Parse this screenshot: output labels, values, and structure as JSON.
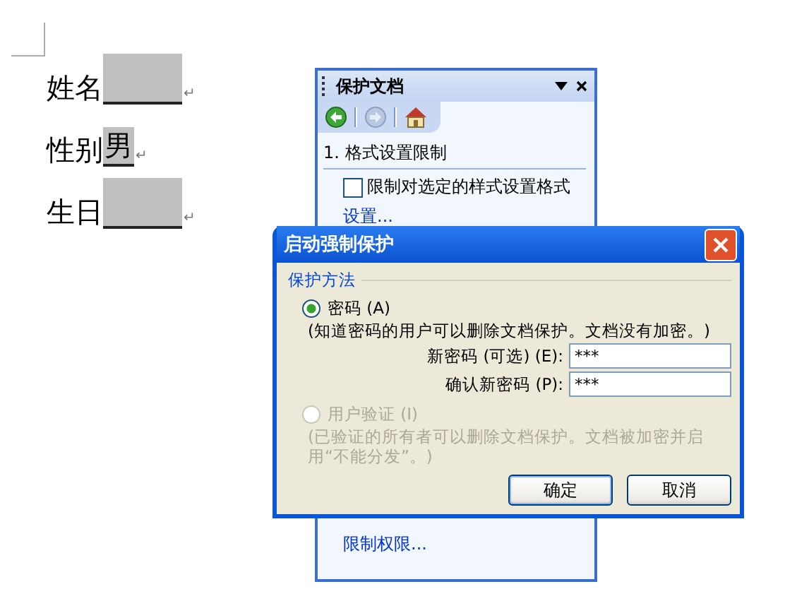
{
  "document": {
    "paragraph_mark": "↵",
    "fields": [
      {
        "label": "姓名"
      },
      {
        "label": "性别",
        "value": "男"
      },
      {
        "label": "生日"
      }
    ]
  },
  "task_pane": {
    "title": "保护文档",
    "nav": [
      {
        "kind": "back",
        "disabled": false
      },
      {
        "kind": "forward",
        "disabled": true
      },
      {
        "kind": "home",
        "disabled": false
      }
    ],
    "section": "1. 格式设置限制",
    "checkbox": {
      "label": "限制对选定的样式设置格式",
      "checked": false
    },
    "link": "设置...",
    "bottom_link": "限制权限..."
  },
  "dialog": {
    "title": "启动强制保护",
    "group": "保护方法",
    "options": [
      {
        "label": "密码 (A)",
        "selected": true,
        "disabled": false,
        "description": "(知道密码的用户可以删除文档保护。文档没有加密。)"
      },
      {
        "label": "用户验证 (I)",
        "selected": false,
        "disabled": true,
        "description": "(已验证的所有者可以删除文档保护。文档被加密并启用“不能分发”。)"
      }
    ],
    "fields": [
      {
        "label": "新密码 (可选) (E):",
        "value": "***"
      },
      {
        "label": "确认新密码 (P):",
        "value": "***"
      }
    ],
    "buttons": [
      "确定",
      "取消"
    ]
  }
}
